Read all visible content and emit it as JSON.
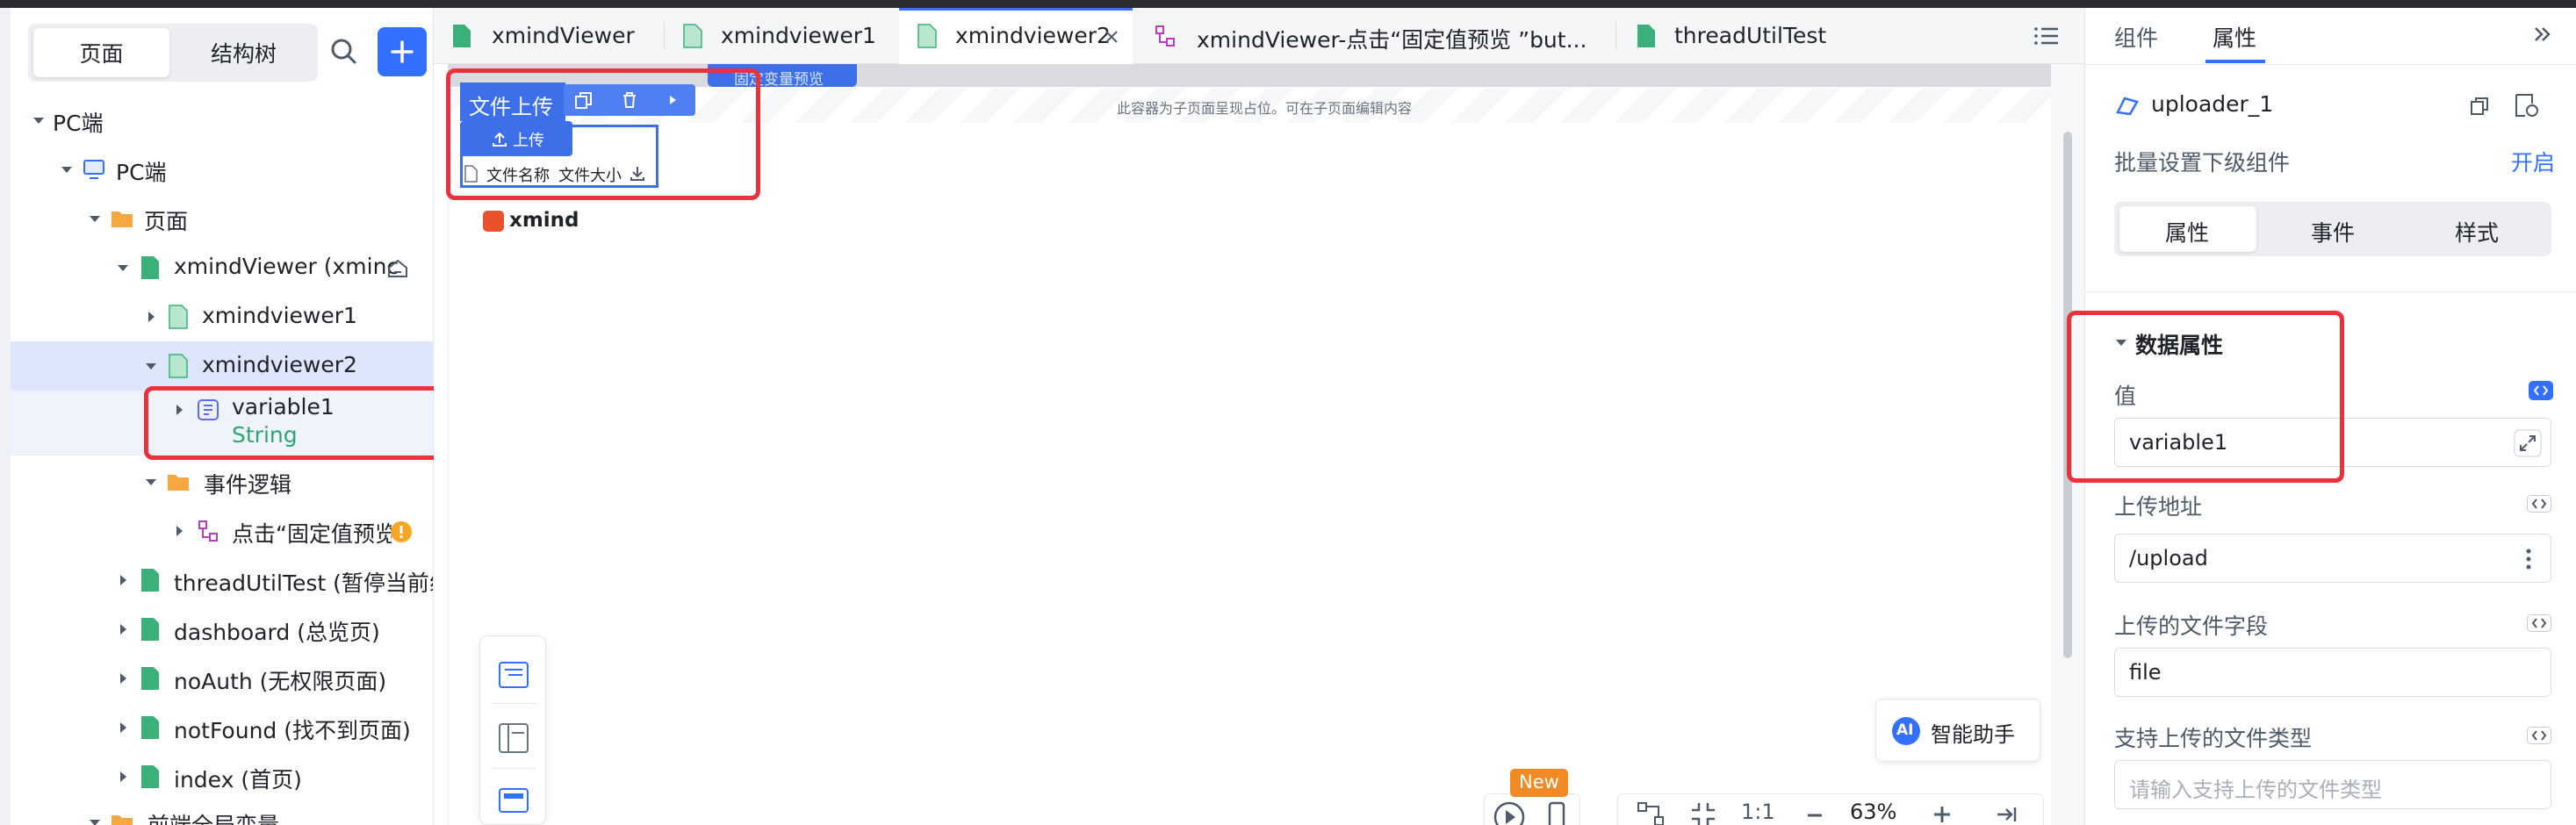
{
  "colors": {
    "accent": "#3370ff",
    "highlight_red": "#e8323c",
    "string_type": "#2ea66f",
    "selected_row": "#dde6fb",
    "warning": "#f5a623"
  },
  "sidebar": {
    "segments": [
      "页面",
      "结构树"
    ],
    "tree": [
      {
        "label": "PC端"
      },
      {
        "label": "PC端"
      },
      {
        "label": "页面"
      },
      {
        "label": "xmindViewer (xminc"
      },
      {
        "label": "xmindviewer1"
      },
      {
        "label": "xmindviewer2"
      },
      {
        "label": "variable1",
        "type": "String"
      },
      {
        "label": "事件逻辑"
      },
      {
        "label": "点击“固定值预览"
      },
      {
        "label": "threadUtilTest (暂停当前线"
      },
      {
        "label": "dashboard (总览页)"
      },
      {
        "label": "noAuth (无权限页面)"
      },
      {
        "label": "notFound (找不到页面)"
      },
      {
        "label": "index (首页)"
      },
      {
        "label": "前端全局变量"
      }
    ]
  },
  "tabs": [
    {
      "label": "xmindViewer"
    },
    {
      "label": "xmindviewer1"
    },
    {
      "label": "xmindviewer2"
    },
    {
      "label": "xmindViewer-点击“固定值预览 ”but..."
    },
    {
      "label": "threadUtilTest"
    }
  ],
  "canvas": {
    "placeholder_hint": "此容器为子页面呈现占位。可在子页面编辑内容",
    "top_btn_2": "固定变量预览",
    "uploader_title": "文件上传",
    "upload_button": "上传",
    "col_name": "文件名称",
    "col_size": "文件大小",
    "xmind_logo": "xmind",
    "ai_label": "AI",
    "ai_assistant": "智能助手",
    "new_badge": "New",
    "zoom_ratio": "1:1",
    "zoom_value": "63%"
  },
  "right_panel": {
    "tabs": [
      "组件",
      "属性"
    ],
    "component_name": "uploader_1",
    "batch_label": "批量设置下级组件",
    "batch_action": "开启",
    "sub_tabs": [
      "属性",
      "事件",
      "样式"
    ],
    "section_title": "数据属性",
    "fields": [
      {
        "label": "值",
        "value": "variable1",
        "placeholder": ""
      },
      {
        "label": "上传地址",
        "value": "/upload",
        "placeholder": ""
      },
      {
        "label": "上传的文件字段",
        "value": "file",
        "placeholder": ""
      },
      {
        "label": "支持上传的文件类型",
        "value": "",
        "placeholder": "请输入支持上传的文件类型"
      }
    ]
  }
}
